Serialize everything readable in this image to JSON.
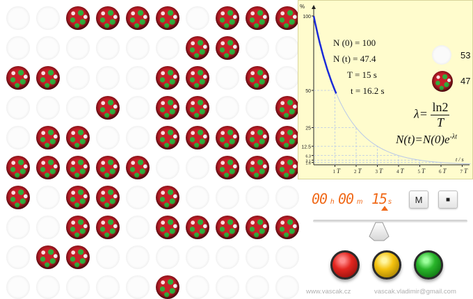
{
  "grid": {
    "rows": 10,
    "cols": 10,
    "active": [
      [
        0,
        0,
        1,
        1,
        1,
        1,
        0,
        1,
        1,
        1
      ],
      [
        0,
        0,
        0,
        0,
        0,
        0,
        1,
        1,
        0,
        0
      ],
      [
        1,
        1,
        0,
        0,
        0,
        1,
        1,
        0,
        1,
        0
      ],
      [
        0,
        0,
        0,
        1,
        0,
        1,
        1,
        0,
        0,
        1
      ],
      [
        0,
        1,
        1,
        0,
        0,
        1,
        1,
        1,
        1,
        1
      ],
      [
        1,
        1,
        1,
        1,
        1,
        0,
        0,
        1,
        1,
        1
      ],
      [
        1,
        0,
        1,
        1,
        0,
        1,
        0,
        0,
        0,
        0
      ],
      [
        0,
        0,
        1,
        1,
        0,
        1,
        1,
        1,
        1,
        1
      ],
      [
        0,
        1,
        1,
        0,
        0,
        0,
        0,
        0,
        0,
        0
      ],
      [
        0,
        0,
        0,
        0,
        0,
        1,
        0,
        0,
        0,
        0
      ]
    ]
  },
  "graph": {
    "y_unit": "%",
    "x_unit": "t / s",
    "y_ticks": [
      "100",
      "50",
      "25",
      "12.5",
      "6.3",
      "3.1",
      "1.6"
    ],
    "x_ticks": [
      {
        "n": "1",
        "s": "T"
      },
      {
        "n": "2",
        "s": "T"
      },
      {
        "n": "3",
        "s": "T"
      },
      {
        "n": "4",
        "s": "T"
      },
      {
        "n": "5",
        "s": "T"
      },
      {
        "n": "6",
        "s": "T"
      },
      {
        "n": "7",
        "s": "T"
      }
    ],
    "progress_in_T": 1.08,
    "labels": {
      "n0": "N (0) = 100",
      "nt": "N (t) = 47.4",
      "T": "T = 15 s",
      "t": "t = 16.2 s"
    },
    "legend": {
      "decayed_count": "53",
      "active_count": "47"
    },
    "formula_lambda_prefix": "λ=",
    "formula_lambda_num": "ln2",
    "formula_lambda_den": "T",
    "formula_decay": "N(t)=N(0)e",
    "formula_decay_exp": "-λt"
  },
  "timer": {
    "hours": "00",
    "hours_unit": "h",
    "minutes": "00",
    "minutes_unit": "m",
    "seconds": "15",
    "seconds_unit": "s"
  },
  "buttons": {
    "m_label": "M",
    "stop_label": "■"
  },
  "footer": {
    "left": "www.vascak.cz",
    "right": "vascak.vladimir@gmail.com"
  },
  "colors": {
    "curve_active": "#1a2ad8",
    "curve_faint": "#b9c8e8",
    "panel_bg": "#fffccd",
    "timer": "#f06a1a"
  }
}
